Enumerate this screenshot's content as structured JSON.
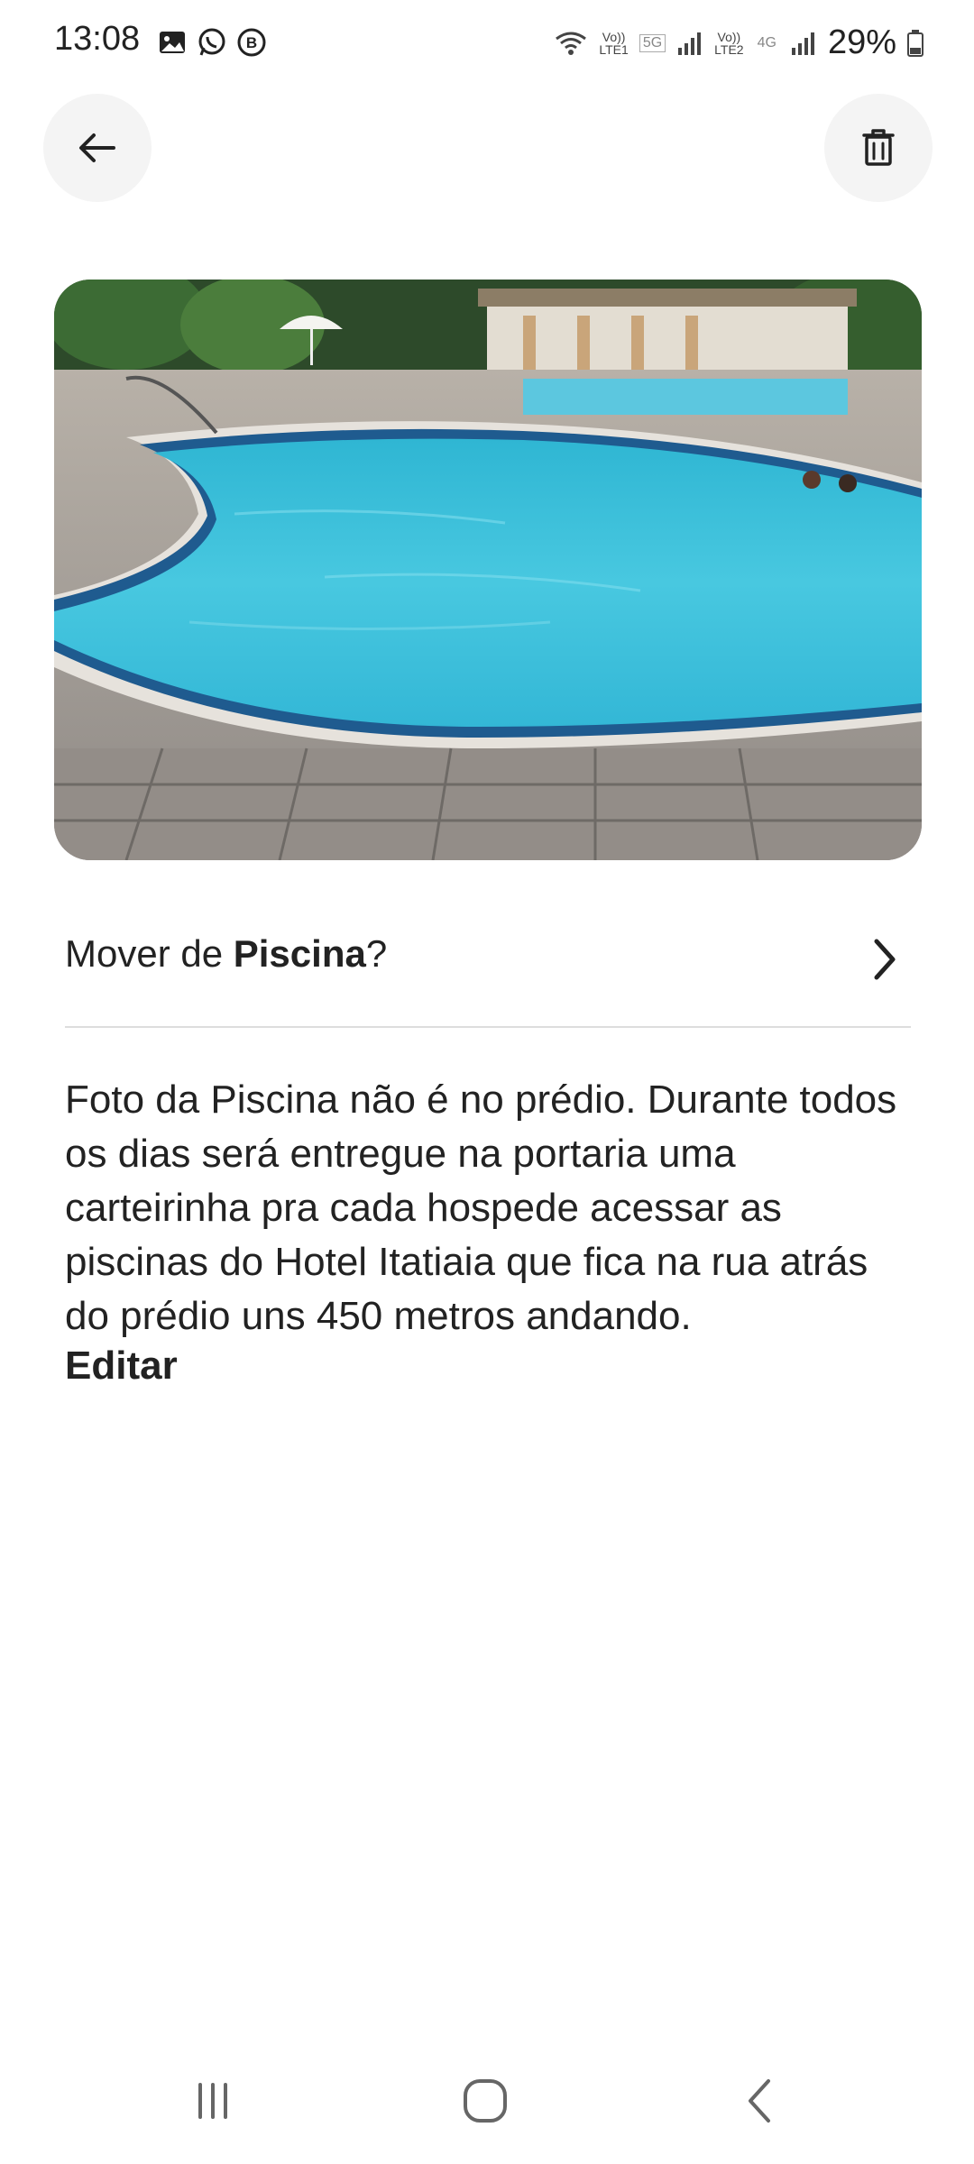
{
  "status_bar": {
    "time": "13:08",
    "left_icons": [
      "gallery-icon",
      "whatsapp-icon",
      "b-badge-icon"
    ],
    "sim1_label_top": "Vo))",
    "sim1_label_bottom": "LTE1",
    "sim1_net": "5G",
    "sim2_label_top": "Vo))",
    "sim2_label_bottom": "LTE2",
    "sim2_net": "4G",
    "battery": "29%"
  },
  "toolbar": {
    "back_icon": "arrow-left-icon",
    "delete_icon": "trash-icon"
  },
  "photo": {
    "subject": "swimming pool photo"
  },
  "move": {
    "prefix": "Mover de ",
    "room": "Piscina",
    "suffix": "?"
  },
  "description": {
    "text": "Foto da Piscina não é no prédio. Durante todos os dias será entregue na portaria uma carteirinha pra cada hospede acessar as piscinas do Hotel Itatiaia que fica na rua atrás do prédio uns 450 metros andando.",
    "edit_label": "Editar"
  },
  "navbar": {
    "recents_icon": "recent-apps-icon",
    "home_icon": "home-icon",
    "back_icon": "back-icon"
  },
  "colors": {
    "pool_water": "#3fc4dc",
    "pool_edge": "#1f5b8f",
    "button_bg": "#f4f4f4",
    "divider": "#dddddd"
  }
}
